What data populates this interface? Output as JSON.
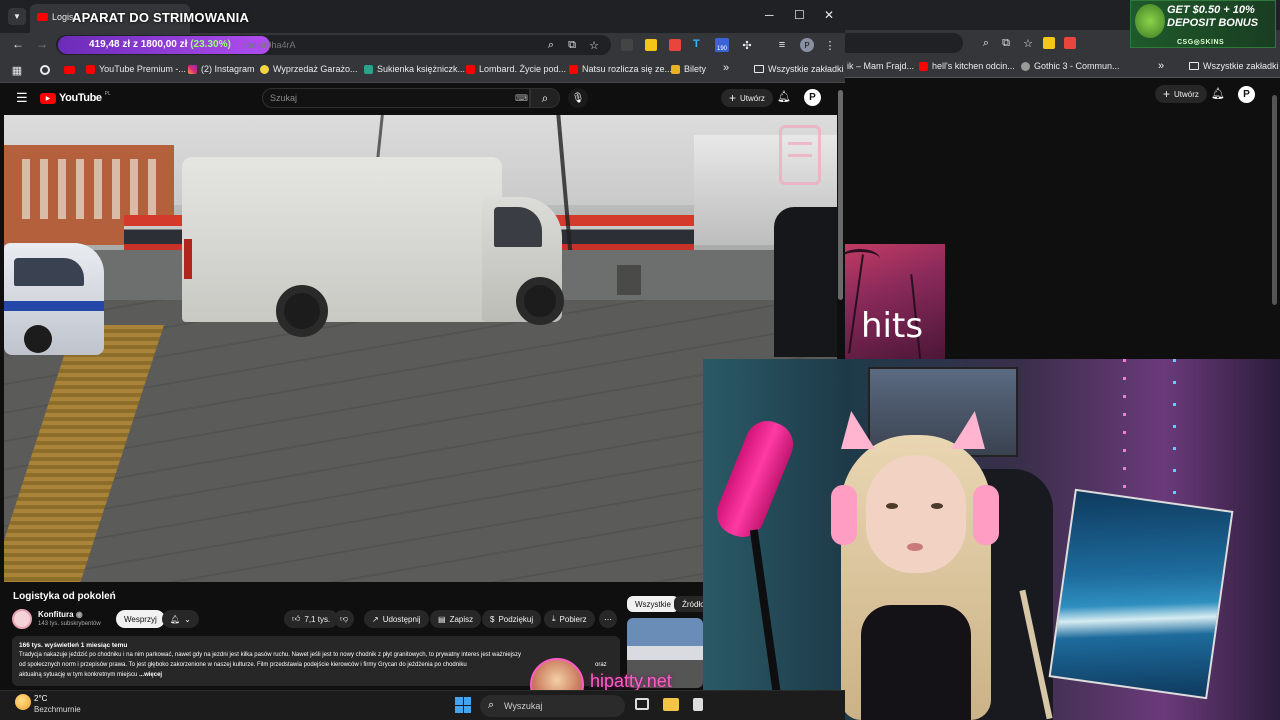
{
  "stream_overlay": {
    "title": "APARAT DO STRIMOWANIA",
    "donation_current": "419,48 zł",
    "donation_sep": "z",
    "donation_goal": "1800,00 zł",
    "donation_percent": "(23.30%)",
    "donation_fraction": 0.233,
    "watermark": "hipatty.net",
    "ad_line1": "GET $0.50 + 10%",
    "ad_line2": "DEPOSIT BONUS",
    "ad_brand": "CSG◎SKINS"
  },
  "main_browser": {
    "tab_label": "Logis",
    "url_tail": "mdl4r9ha4rA",
    "bookmarks": [
      "YouTube Premium -...",
      "(2) Instagram",
      "Wyprzedaż Garażo...",
      "Sukienka księżniczk...",
      "Lombard. Życie pod...",
      "Natsu rozlicza się ze...",
      "Bilety"
    ],
    "more_bookmarks": "»",
    "all_bookmarks": "Wszystkie zakładki",
    "extension_badge": "190"
  },
  "youtube": {
    "logo_text": "YouTube",
    "logo_region": "PL",
    "search_placeholder": "Szukaj",
    "create_label": "Utwórz",
    "avatar_letter": "P",
    "video_title": "Logistyka od pokoleń",
    "channel_name": "Konfitura",
    "channel_subs": "143 tys. subskrybentów",
    "support_label": "Wesprzyj",
    "like_count": "7,1 tys.",
    "share_label": "Udostępnij",
    "save_label": "Zapisz",
    "thanks_label": "Podziękuj",
    "download_label": "Pobierz",
    "desc_meta": "166 tys. wyświetleń  1 miesiąc temu",
    "desc_text_1": "Tradycja nakazuje jeździć po chodniku i na nim parkować, nawet gdy na jezdni jest kilka pasów ruchu. Nawet jeśli jest to nowy chodnik z płyt granitowych, to prywatny interes jest ważniejszy",
    "desc_text_2": "od społecznych norm i przepisów prawa. To jest głęboko zakorzenione w naszej kulturze. Film przedstawia podejście kierowców i firmy Grycan do jeżdżenia po chodniku",
    "desc_text_2b": "oraz",
    "desc_text_3": "aktualną sytuację w tym konkretnym miejscu",
    "desc_more": "...więcej",
    "chip_all": "Wszystkie",
    "chip_source": "Źródło:"
  },
  "bg_browser": {
    "bookmarks": [
      "ik – Mam Frajd...",
      "hell's kitchen odcin...",
      "Gothic 3 - Commun..."
    ],
    "more_bookmarks": "»",
    "all_bookmarks": "Wszystkie zakładki",
    "create_label": "Utwórz",
    "avatar_letter": "P",
    "thumb_text": "hits"
  },
  "taskbar": {
    "temp": "2°C",
    "weather": "Bezchmurnie",
    "search_placeholder": "Wyszukaj"
  },
  "colors": {
    "progress_fill": "#8d3bd8",
    "youtube_red": "#ff0000",
    "overlay_pink": "#ff5cc8"
  }
}
